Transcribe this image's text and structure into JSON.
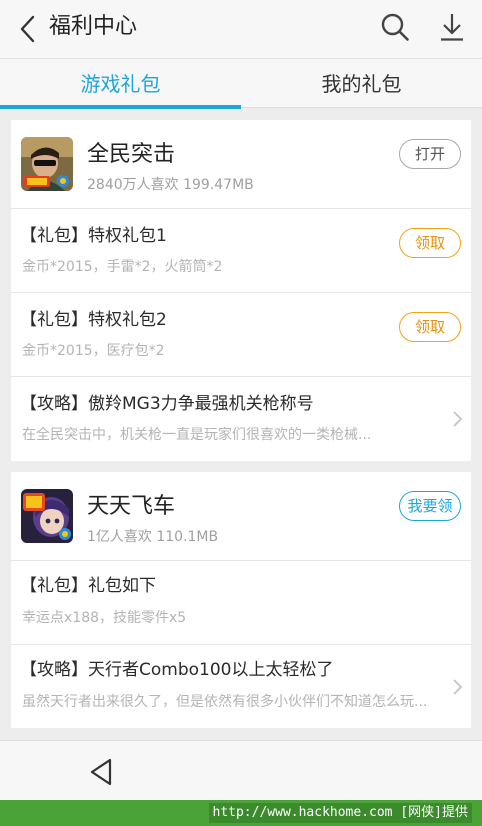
{
  "header": {
    "title": "福利中心",
    "back_icon": "back-arrow-icon",
    "search_icon": "search-icon",
    "download_icon": "download-icon"
  },
  "tabs": [
    {
      "label": "游戏礼包",
      "active": true
    },
    {
      "label": "我的礼包",
      "active": false
    }
  ],
  "colors": {
    "accent": "#1fa6d8",
    "claim": "#f3a316",
    "watermark_bg": "#49a337"
  },
  "games": [
    {
      "name": "全民突击",
      "meta": "2840万人喜欢  199.47MB",
      "action": "打开",
      "items": [
        {
          "title": "【礼包】特权礼包1",
          "desc": "金币*2015，手雷*2，火箭筒*2",
          "action": "领取"
        },
        {
          "title": "【礼包】特权礼包2",
          "desc": "金币*2015，医疗包*2",
          "action": "领取"
        },
        {
          "title": "【攻略】傲羚MG3力争最强机关枪称号",
          "desc": "在全民突击中，机关枪一直是玩家们很喜欢的一类枪械..."
        }
      ]
    },
    {
      "name": "天天飞车",
      "meta": "1亿人喜欢  110.1MB",
      "action": "我要领",
      "items": [
        {
          "title": "【礼包】礼包如下",
          "desc": "幸运点x188，技能零件x5"
        },
        {
          "title": "【攻略】天行者Combo100以上太轻松了",
          "desc": "虽然天行者出来很久了，但是依然有很多小伙伴们不知道怎么玩..."
        }
      ]
    }
  ],
  "watermark": "http://www.hackhome.com [网侠]提供"
}
